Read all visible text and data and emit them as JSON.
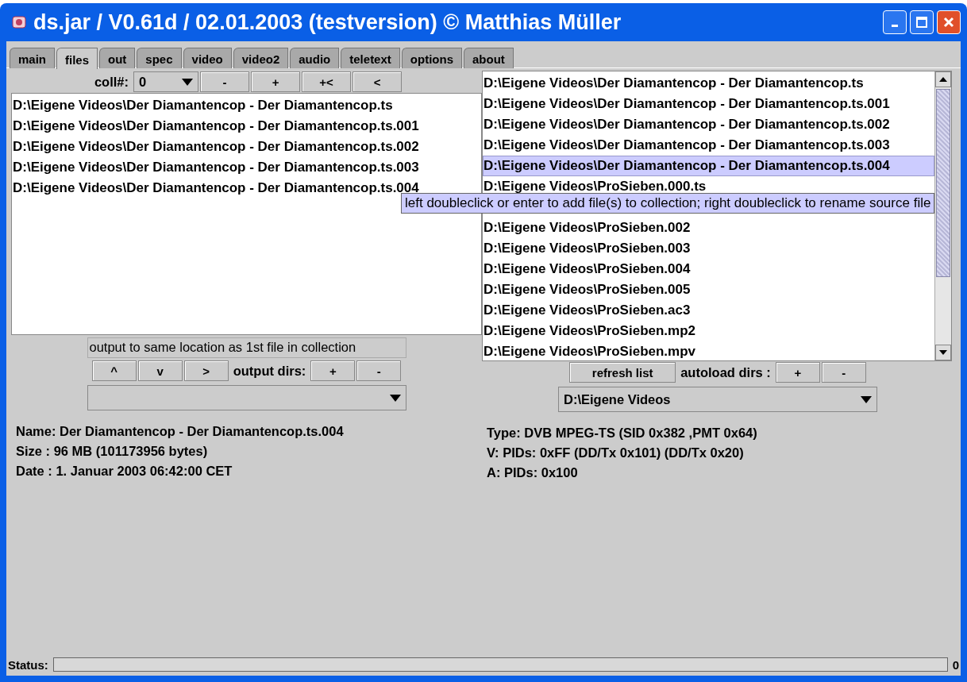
{
  "window": {
    "title": "ds.jar / V0.61d / 02.01.2003 (testversion) © Matthias Müller"
  },
  "tabs": [
    {
      "label": "main",
      "selected": false
    },
    {
      "label": "files",
      "selected": true
    },
    {
      "label": "out",
      "selected": false
    },
    {
      "label": "spec",
      "selected": false
    },
    {
      "label": "video",
      "selected": false
    },
    {
      "label": "video2",
      "selected": false
    },
    {
      "label": "audio",
      "selected": false
    },
    {
      "label": "teletext",
      "selected": false
    },
    {
      "label": "options",
      "selected": false
    },
    {
      "label": "about",
      "selected": false
    }
  ],
  "collection": {
    "label": "coll#:",
    "combo": "0",
    "buttons": [
      "-",
      "+",
      "+<",
      "<"
    ],
    "files": [
      "D:\\Eigene Videos\\Der Diamantencop - Der Diamantencop.ts",
      "D:\\Eigene Videos\\Der Diamantencop - Der Diamantencop.ts.001",
      "D:\\Eigene Videos\\Der Diamantencop - Der Diamantencop.ts.002",
      "D:\\Eigene Videos\\Der Diamantencop - Der Diamantencop.ts.003",
      "D:\\Eigene Videos\\Der Diamantencop - Der Diamantencop.ts.004"
    ],
    "output_note": "output to same location as 1st file in collection",
    "nav_buttons": [
      "^",
      "v",
      ">"
    ],
    "output_dirs_label": "output dirs:",
    "output_dirs_buttons": [
      "+",
      "-"
    ]
  },
  "source": {
    "files": [
      {
        "name": "D:\\Eigene Videos\\Der Diamantencop - Der Diamantencop.ts",
        "selected": false
      },
      {
        "name": "D:\\Eigene Videos\\Der Diamantencop - Der Diamantencop.ts.001",
        "selected": false
      },
      {
        "name": "D:\\Eigene Videos\\Der Diamantencop - Der Diamantencop.ts.002",
        "selected": false
      },
      {
        "name": "D:\\Eigene Videos\\Der Diamantencop - Der Diamantencop.ts.003",
        "selected": false
      },
      {
        "name": "D:\\Eigene Videos\\Der Diamantencop - Der Diamantencop.ts.004",
        "selected": true
      },
      {
        "name": "D:\\Eigene Videos\\ProSieben.000.ts",
        "selected": false
      },
      {
        "name": "D:\\Eigene Videos\\ProSieben.002",
        "selected": false
      },
      {
        "name": "D:\\Eigene Videos\\ProSieben.003",
        "selected": false
      },
      {
        "name": "D:\\Eigene Videos\\ProSieben.004",
        "selected": false
      },
      {
        "name": "D:\\Eigene Videos\\ProSieben.005",
        "selected": false
      },
      {
        "name": "D:\\Eigene Videos\\ProSieben.ac3",
        "selected": false
      },
      {
        "name": "D:\\Eigene Videos\\ProSieben.mp2",
        "selected": false
      },
      {
        "name": "D:\\Eigene Videos\\ProSieben.mpv",
        "selected": false
      }
    ],
    "tooltip": "left doubleclick or enter to add file(s) to collection; right doubleclick to rename source file",
    "refresh_button": "refresh list",
    "autoload_label": "autoload dirs :",
    "autoload_buttons": [
      "+",
      "-"
    ],
    "autoload_dir": "D:\\Eigene Videos"
  },
  "file_info": [
    "Name: Der Diamantencop - Der Diamantencop.ts.004",
    "Size  : 96 MB (101173956 bytes)",
    "Date : 1. Januar 2003  06:42:00 CET"
  ],
  "stream_info": [
    "Type:  DVB MPEG-TS (SID 0x382 ,PMT 0x64)",
    "V: PIDs: 0xFF (DD/Tx 0x101) (DD/Tx 0x20)",
    "A: PIDs: 0x100"
  ],
  "status": {
    "label": "Status:",
    "value": "0"
  }
}
